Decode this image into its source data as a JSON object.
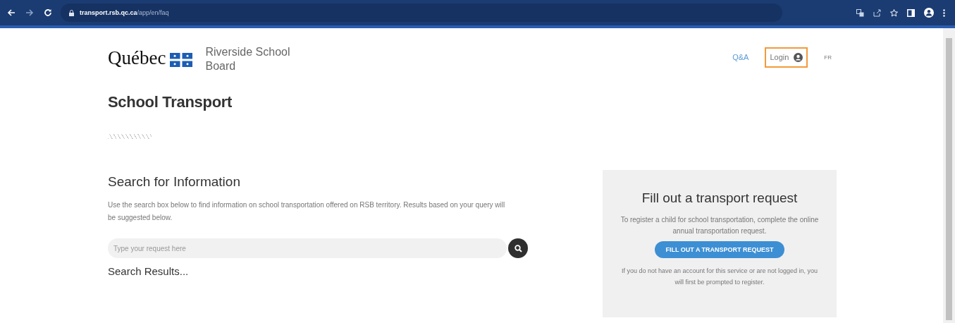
{
  "browser": {
    "url_host": "transport.rsb.qc.ca",
    "url_path": "/app/en/faq"
  },
  "header": {
    "logo_text": "Québec",
    "org_name": "Riverside School Board",
    "nav": [
      {
        "label": "Q&A",
        "kind": "link",
        "highlighted": false
      },
      {
        "label": "Login",
        "kind": "login",
        "highlighted": true
      },
      {
        "label": "FR",
        "kind": "lang",
        "highlighted": false
      }
    ]
  },
  "page_title": "School Transport",
  "search": {
    "heading": "Search for Information",
    "description": "Use the search box below to find information on school transportation offered on RSB territory. Results based on your query will be suggested below.",
    "placeholder": "Type your request here",
    "results_heading": "Search Results..."
  },
  "request_card": {
    "title": "Fill out a transport request",
    "text": "To register a child for school transportation, complete the online annual transportation request.",
    "button": "FILL OUT A TRANSPORT REQUEST",
    "note": "If you do not have an account for this service or are not logged in, you will first be prompted to register."
  }
}
